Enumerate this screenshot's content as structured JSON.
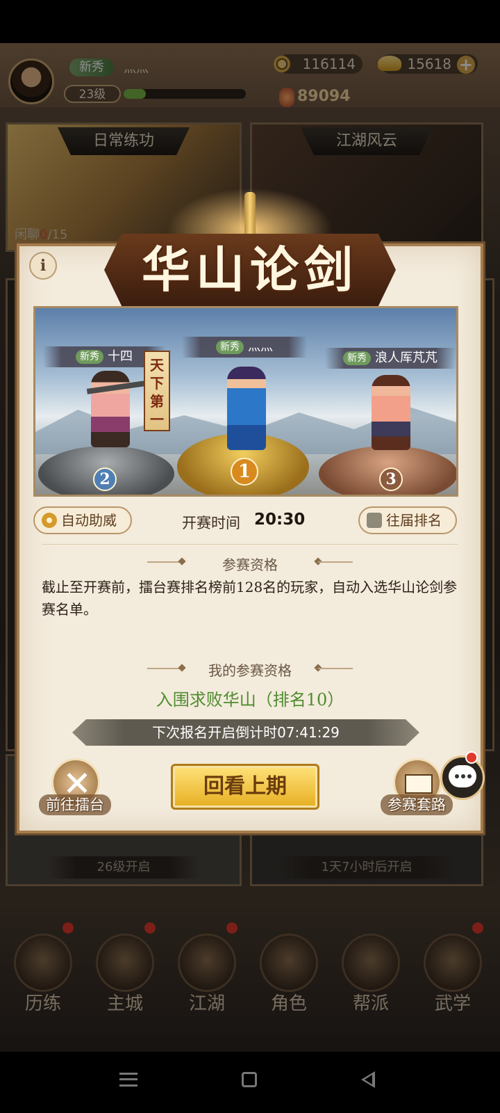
{
  "player": {
    "title_badge": "新秀",
    "name": "灬灬",
    "level": "23级",
    "xp_fraction": 0.18,
    "copper": "116114",
    "gold": "15618",
    "power": "89094"
  },
  "background_cards": {
    "daily": {
      "title": "日常练功",
      "stat_left": "闲聊",
      "stat_value_red": "0",
      "stat_suffix": "/15"
    },
    "jianghu": {
      "title": "江湖风云"
    },
    "locked_left": {
      "footer": "26级开启"
    },
    "locked_right": {
      "footer": "1天7小时后开启"
    }
  },
  "bottom_nav": [
    {
      "label": "历练",
      "has_dot": true
    },
    {
      "label": "主城",
      "has_dot": true
    },
    {
      "label": "江湖",
      "has_dot": true
    },
    {
      "label": "角色",
      "has_dot": false
    },
    {
      "label": "帮派",
      "has_dot": false
    },
    {
      "label": "武学",
      "has_dot": true
    }
  ],
  "modal": {
    "title": "华山论剑",
    "info_icon": "i",
    "arena": {
      "champion_banner": "天下第一",
      "ranks": [
        {
          "rank": "1",
          "badge": "新秀",
          "name": "灬灬"
        },
        {
          "rank": "2",
          "badge": "新秀",
          "name": "十四"
        },
        {
          "rank": "3",
          "badge": "新秀",
          "name": "浪人厍芃芃"
        }
      ]
    },
    "auto_cheer_label": "自动助威",
    "start_time_label": "开赛时间",
    "start_time_value": "20:30",
    "history_rank_label": "往届排名",
    "qualification_header": "参赛资格",
    "qualification_text": "截止至开赛前，擂台赛排名榜前128名的玩家，自动入选华山论剑参赛名单。",
    "my_qualification_header": "我的参赛资格",
    "my_status": "入围求败华山（排名10）",
    "countdown": "下次报名开启倒计时07:41:29",
    "goto_arena_label": "前往擂台",
    "replay_label": "回看上期",
    "strategy_label": "参赛套路"
  },
  "colors": {
    "modal_bg": "#f3ebdc",
    "status_green": "#4f8b2f",
    "replay_gold": "#e6ae21",
    "notice_red": "#e03a2c"
  },
  "icons": {
    "copper": "coin-icon",
    "gold": "ingot-icon",
    "add": "plus-icon",
    "auto_cheer": "gear-icon",
    "history": "crossed-swords-icon",
    "goto_arena": "crossed-swords-icon",
    "strategy": "book-icon",
    "chat": "chat-bubble-icon"
  }
}
